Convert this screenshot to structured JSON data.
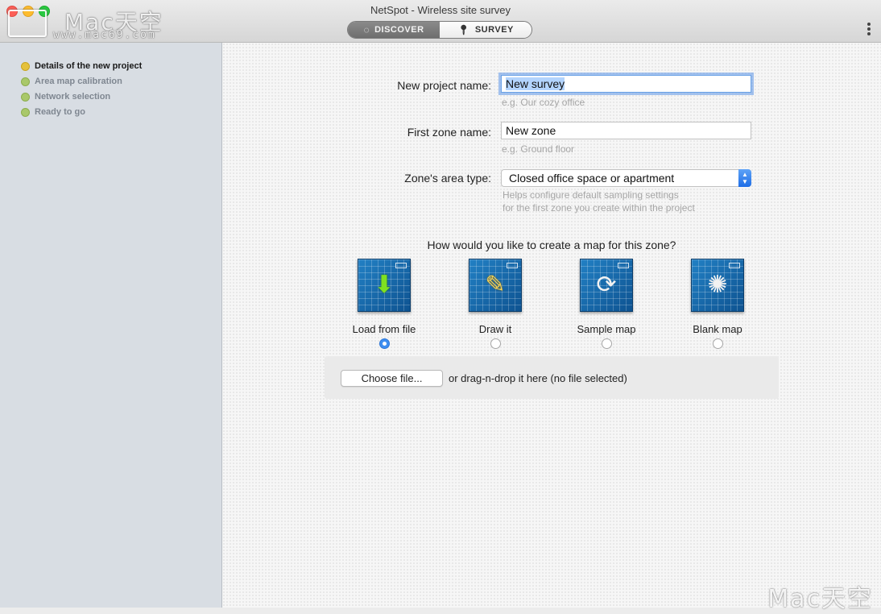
{
  "window": {
    "title": "NetSpot - Wireless site survey",
    "watermark_logo": "Mac天空",
    "watermark_url": "www.mac69.com"
  },
  "mode_switch": {
    "discover_label": "DISCOVER",
    "survey_label": "SURVEY",
    "selected": "SURVEY"
  },
  "sidebar": {
    "steps": [
      {
        "label": "Details of the new project",
        "state": "active"
      },
      {
        "label": "Area map calibration",
        "state": "pending"
      },
      {
        "label": "Network selection",
        "state": "pending"
      },
      {
        "label": "Ready to go",
        "state": "pending"
      }
    ]
  },
  "form": {
    "project_name": {
      "label": "New project name:",
      "value": "New survey",
      "hint": "e.g. Our cozy office"
    },
    "zone_name": {
      "label": "First zone name:",
      "value": "New zone",
      "hint": "e.g. Ground floor"
    },
    "area_type": {
      "label": "Zone's area type:",
      "value": "Closed office space or apartment",
      "hint_line1": "Helps configure default sampling settings",
      "hint_line2": "for the first zone you create within the project"
    }
  },
  "map_creation": {
    "question": "How would you like to create a map for this zone?",
    "options": [
      {
        "label": "Load from file",
        "icon": "download-arrow-icon",
        "selected": true
      },
      {
        "label": "Draw it",
        "icon": "pencil-icon",
        "selected": false
      },
      {
        "label": "Sample map",
        "icon": "refresh-icon",
        "selected": false
      },
      {
        "label": "Blank map",
        "icon": "spinner-icon",
        "selected": false
      }
    ]
  },
  "file_picker": {
    "button_label": "Choose file...",
    "status_text": "or drag-n-drop it here (no file selected)"
  },
  "colors": {
    "accent": "#3e8ef0",
    "active_step": "#e5c13b",
    "pending_step": "#a9c86a",
    "map_tile": "#1b74b5"
  }
}
